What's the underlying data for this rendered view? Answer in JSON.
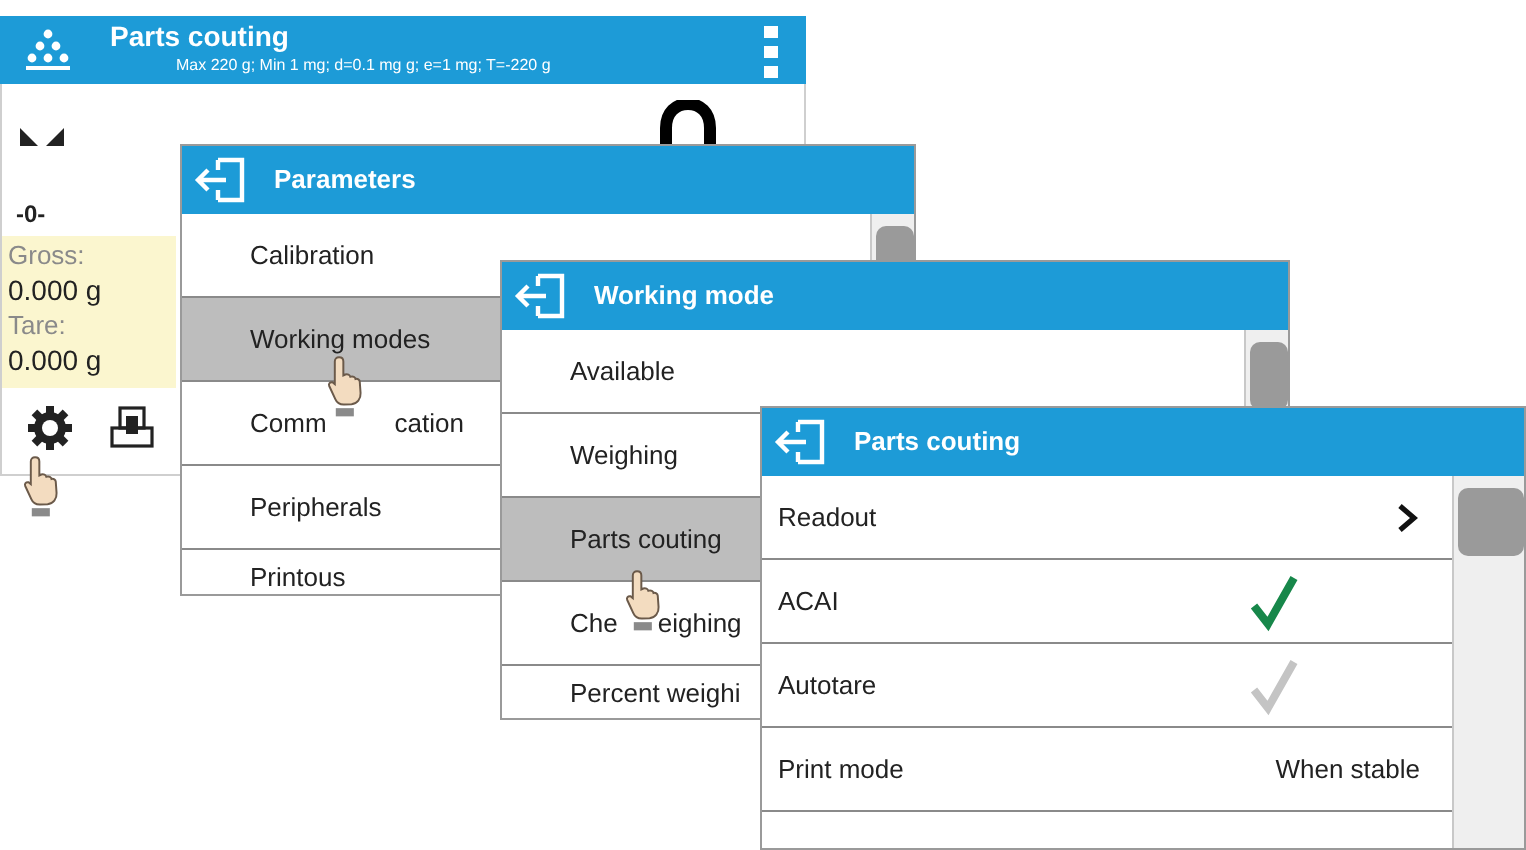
{
  "main_screen": {
    "title": "Parts couting",
    "subtitle": "Max 220 g; Min 1 mg; d=0.1 mg g; e=1 mg; T=-220 g",
    "zero_indicator": "-0-",
    "info": [
      {
        "label": "Gross:",
        "value": "0.000 g"
      },
      {
        "label": "Tare:",
        "value": "0.000 g"
      }
    ]
  },
  "windows": [
    {
      "title": "Parameters",
      "items": [
        {
          "kind": "link",
          "parts": [
            "Calibration"
          ],
          "selected": false
        },
        {
          "kind": "link",
          "parts": [
            "Working modes"
          ],
          "selected": true
        },
        {
          "kind": "link",
          "parts": [
            "Comm",
            "cation"
          ],
          "selected": false
        },
        {
          "kind": "link",
          "parts": [
            "Peripherals"
          ],
          "selected": false
        },
        {
          "kind": "link",
          "parts": [
            "Printous"
          ],
          "selected": false
        }
      ]
    },
    {
      "title": "Working mode",
      "items": [
        {
          "kind": "link",
          "parts": [
            "Available"
          ],
          "selected": false
        },
        {
          "kind": "link",
          "parts": [
            "Weighing"
          ],
          "selected": false
        },
        {
          "kind": "link",
          "parts": [
            "Parts couting"
          ],
          "selected": true
        },
        {
          "kind": "link",
          "parts": [
            "Che",
            "eighing"
          ],
          "selected": false
        },
        {
          "kind": "link",
          "parts": [
            "Percent weighi"
          ],
          "selected": false
        }
      ]
    },
    {
      "title": "Parts couting",
      "items": [
        {
          "kind": "submenu",
          "parts": [
            "Readout"
          ],
          "selected": false
        },
        {
          "kind": "checkbox",
          "parts": [
            "ACAI"
          ],
          "checked": true,
          "selected": false
        },
        {
          "kind": "checkbox",
          "parts": [
            "Autotare"
          ],
          "checked": false,
          "selected": false
        },
        {
          "kind": "value",
          "parts": [
            "Print mode"
          ],
          "value": "When stable",
          "selected": false
        }
      ]
    }
  ]
}
